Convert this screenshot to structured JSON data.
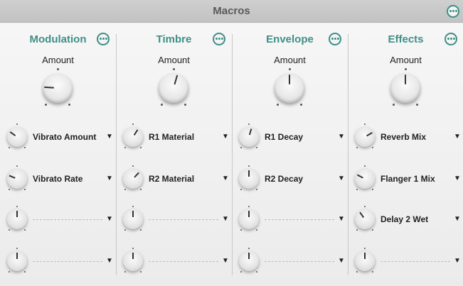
{
  "header": {
    "title": "Macros",
    "more_icon": "more-options-icon"
  },
  "colors": {
    "accent": "#3e8f87",
    "title_bar": "#c6c6c6",
    "background": "#eeeeee"
  },
  "columns": [
    {
      "title": "Modulation",
      "amount": {
        "label": "Amount",
        "value": 0.18
      },
      "slots": [
        {
          "label": "Vibrato Amount",
          "value": 0.3,
          "assigned": true
        },
        {
          "label": "Vibrato Rate",
          "value": 0.25,
          "assigned": true
        },
        {
          "label": "",
          "value": 0.5,
          "assigned": false
        },
        {
          "label": "",
          "value": 0.5,
          "assigned": false
        }
      ]
    },
    {
      "title": "Timbre",
      "amount": {
        "label": "Amount",
        "value": 0.56
      },
      "slots": [
        {
          "label": "R1 Material",
          "value": 0.62,
          "assigned": true
        },
        {
          "label": "R2 Material",
          "value": 0.66,
          "assigned": true
        },
        {
          "label": "",
          "value": 0.5,
          "assigned": false
        },
        {
          "label": "",
          "value": 0.5,
          "assigned": false
        }
      ]
    },
    {
      "title": "Envelope",
      "amount": {
        "label": "Amount",
        "value": 0.5
      },
      "slots": [
        {
          "label": "R1 Decay",
          "value": 0.56,
          "assigned": true
        },
        {
          "label": "R2 Decay",
          "value": 0.5,
          "assigned": true
        },
        {
          "label": "",
          "value": 0.5,
          "assigned": false
        },
        {
          "label": "",
          "value": 0.5,
          "assigned": false
        }
      ]
    },
    {
      "title": "Effects",
      "amount": {
        "label": "Amount",
        "value": 0.5
      },
      "slots": [
        {
          "label": "Reverb Mix",
          "value": 0.72,
          "assigned": true
        },
        {
          "label": "Flanger 1 Mix",
          "value": 0.27,
          "assigned": true
        },
        {
          "label": "Delay 2 Wet",
          "value": 0.37,
          "assigned": true
        },
        {
          "label": "",
          "value": 0.5,
          "assigned": false
        }
      ]
    }
  ]
}
